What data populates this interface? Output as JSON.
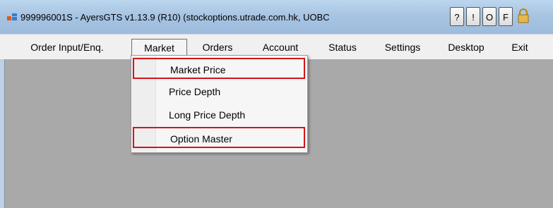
{
  "window": {
    "title": "999996001S - AyersGTS v1.13.9 (R10) (stockoptions.utrade.com.hk, UOBC",
    "buttons": [
      "?",
      "!",
      "O",
      "F"
    ]
  },
  "menubar": {
    "items": [
      "Order Input/Enq.",
      "Market",
      "Orders",
      "Account",
      "Status",
      "Settings",
      "Desktop",
      "Exit"
    ],
    "active": "Market"
  },
  "dropdown": {
    "items": [
      {
        "label": "Market Price",
        "highlighted": true
      },
      {
        "label": "Price Depth",
        "highlighted": false
      },
      {
        "label": "Long Price Depth",
        "highlighted": false
      },
      {
        "label": "Option Master",
        "highlighted": true
      }
    ]
  },
  "colors": {
    "highlight_border": "#d0161a",
    "workspace": "#a9a9a9"
  }
}
